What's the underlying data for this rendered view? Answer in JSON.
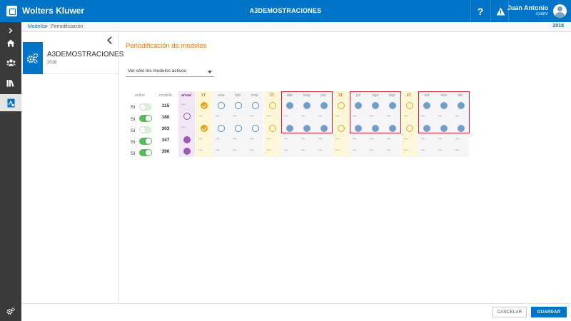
{
  "app": {
    "brand": "Wolters Kluwer",
    "company": "A3DEMOSTRACIONES",
    "help_icon": "question-icon",
    "alert_icon": "warning-icon",
    "user": {
      "name": "Juan Antonio",
      "id": "0388V"
    }
  },
  "rail": {
    "items": [
      {
        "name": "expand",
        "icon": "chevron-right-icon"
      },
      {
        "name": "home",
        "icon": "home-icon"
      },
      {
        "name": "users",
        "icon": "users-icon"
      },
      {
        "name": "library",
        "icon": "library-icon"
      },
      {
        "name": "models",
        "icon": "document-icon",
        "active": true
      }
    ],
    "settings_icon": "gear-icon"
  },
  "breadcrumb": {
    "link": "Modelos",
    "separator": ">",
    "current": "Periodificación",
    "year": "2018"
  },
  "panel": {
    "title": "A3DEMOSTRACIONES",
    "subtitle": "2018",
    "icon": "gears-icon",
    "collapse_icon": "chevron-left-icon"
  },
  "main": {
    "title": "Periodificación de modelos",
    "filter": {
      "selected": "Ver sólo los modelos activos"
    }
  },
  "table": {
    "headers": {
      "activo": "activo",
      "modelo": "modelo",
      "anual": "anual",
      "q1": "1T",
      "ene": "ene",
      "feb": "feb",
      "mar": "mar",
      "q2": "2T",
      "abr": "abr",
      "may": "may",
      "jun": "jun",
      "q3": "3T",
      "jul": "jul",
      "ago": "ago",
      "sep": "sep",
      "q4": "4T",
      "oct": "oct",
      "nov": "nov",
      "dic": "dic"
    },
    "dash": "•••",
    "rows": [
      {
        "active_label": "Sí",
        "active": false,
        "modelo": "115"
      },
      {
        "active_label": "Sí",
        "active": true,
        "modelo": "180"
      },
      {
        "active_label": "Sí",
        "active": false,
        "modelo": "303"
      },
      {
        "active_label": "Sí",
        "active": true,
        "modelo": "347"
      },
      {
        "active_label": "Sí",
        "active": true,
        "modelo": "390"
      }
    ]
  },
  "colors": {
    "brand_blue": "#0074c7",
    "accent_orange": "#e07b12",
    "highlight_red": "#d61f2b",
    "purple": "#9b5ab8",
    "toggle_green": "#5cb85c"
  },
  "footer": {
    "cancel": "CANCELAR",
    "save": "GUARDAR"
  }
}
